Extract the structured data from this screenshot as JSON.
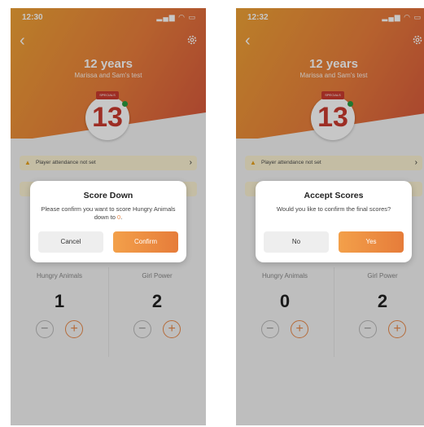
{
  "screens": [
    {
      "status": {
        "time": "12:30",
        "icons": "▂▄▆ ◠ ▭"
      },
      "header": {
        "title": "12 years",
        "subtitle": "Marissa and Sam's test"
      },
      "badge": {
        "number": "13",
        "ribbon": "SPECIALS"
      },
      "alert": {
        "text": "Player attendance not set",
        "chevron": "›"
      },
      "teams": [
        {
          "name": "Hungry Animals",
          "score": "1"
        },
        {
          "name": "Girl Power",
          "score": "2"
        }
      ],
      "dialog": {
        "title": "Score Down",
        "message_main": "Please confirm you want to score Hungry Animals down to ",
        "message_value": "0",
        "message_end": ".",
        "cancel_label": "Cancel",
        "confirm_label": "Confirm"
      }
    },
    {
      "status": {
        "time": "12:32",
        "icons": "▂▄▆ ◠ ▭"
      },
      "header": {
        "title": "12 years",
        "subtitle": "Marissa and Sam's test"
      },
      "badge": {
        "number": "13",
        "ribbon": "SPECIALS"
      },
      "alert": {
        "text": "Player attendance not set",
        "chevron": "›"
      },
      "teams": [
        {
          "name": "Hungry Animals",
          "score": "0"
        },
        {
          "name": "Girl Power",
          "score": "2"
        }
      ],
      "dialog": {
        "title": "Accept Scores",
        "message": "Would you like to confirm the final scores?",
        "cancel_label": "No",
        "confirm_label": "Yes"
      }
    }
  ],
  "icons": {
    "back": "back-chevron-icon",
    "settings": "gear-icon",
    "warning": "warning-icon",
    "minus": "minus-icon",
    "plus": "plus-icon"
  },
  "colors": {
    "accent": "#e8894a",
    "brand_gradient_start": "#f0a336",
    "brand_gradient_end": "#d6553c",
    "badge_red": "#c93a2f",
    "alert_bg": "#fbf3d2"
  }
}
